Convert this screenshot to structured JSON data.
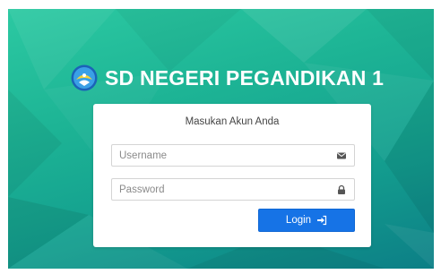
{
  "header": {
    "title": "SD NEGERI PEGANDIKAN 1",
    "logo_icon": "tut-wuri-handayani-logo"
  },
  "login_form": {
    "heading": "Masukan Akun Anda",
    "username": {
      "placeholder": "Username",
      "value": "",
      "icon": "envelope-icon"
    },
    "password": {
      "placeholder": "Password",
      "value": "",
      "icon": "lock-icon"
    },
    "login_button": {
      "label": "Login",
      "icon": "sign-in-icon"
    }
  },
  "colors": {
    "background_gradient": [
      "#2cc9a2",
      "#0c7f86"
    ],
    "button": "#1673e6",
    "card": "#ffffff"
  }
}
